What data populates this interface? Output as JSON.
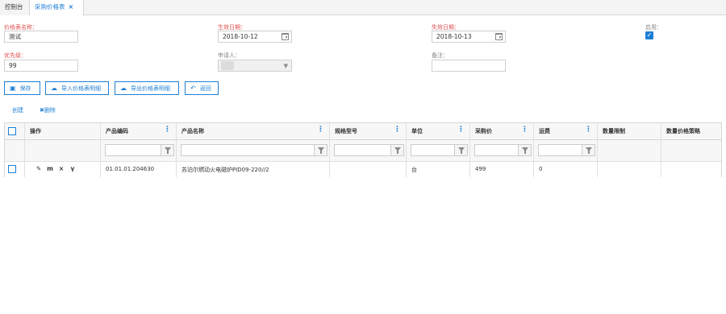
{
  "tabs": [
    {
      "label": "控制台"
    },
    {
      "label": "采购价格表",
      "close": "×"
    }
  ],
  "form": {
    "name": {
      "label": "价格表名称：",
      "value": "测试"
    },
    "start_date": {
      "label": "生效日期：",
      "value": "2018-10-12"
    },
    "end_date": {
      "label": "失效日期：",
      "value": "2018-10-13"
    },
    "enabled": {
      "label": "启用：",
      "checked": true,
      "mark": "✓"
    },
    "priority": {
      "label": "优先级：",
      "value": "99"
    },
    "applicant": {
      "label": "申请人：",
      "value": ""
    },
    "remark": {
      "label": "备注：",
      "value": ""
    }
  },
  "toolbar": {
    "save": "保存",
    "import": "导入价格表明细",
    "export": "导出价格表明细",
    "back": "返回"
  },
  "links": {
    "create": "创建",
    "delete": "删除",
    "delete_mark": "✖"
  },
  "grid": {
    "columns": [
      "操作",
      "产品编码",
      "产品名称",
      "规格型号",
      "单位",
      "采购价",
      "运费",
      "数量限制",
      "数量价格策略"
    ],
    "rows": [
      {
        "code": "01.01.01.204630",
        "name": "苏泊尔燃动火电磁炉PID09-220//2",
        "spec": "",
        "unit": "台",
        "price": "499",
        "freight": "0",
        "qty_limit": "",
        "qty_strategy": ""
      }
    ],
    "row_actions": [
      "✎",
      "m",
      "×",
      "ү"
    ]
  },
  "colors": {
    "accent": "#1e7fd6",
    "required": "#e05050"
  }
}
